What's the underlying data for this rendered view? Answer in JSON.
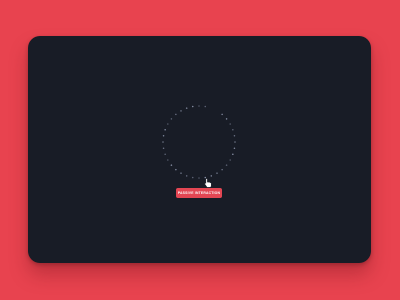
{
  "colors": {
    "background": "#e8434f",
    "panel": "#181c26",
    "accent": "#e34653",
    "dots": "#8a92a8"
  },
  "loader": {
    "icon": "dotted-ring-spinner-icon"
  },
  "button": {
    "label": "Passive Interaction"
  },
  "cursor": {
    "icon": "hand-pointer-icon"
  }
}
